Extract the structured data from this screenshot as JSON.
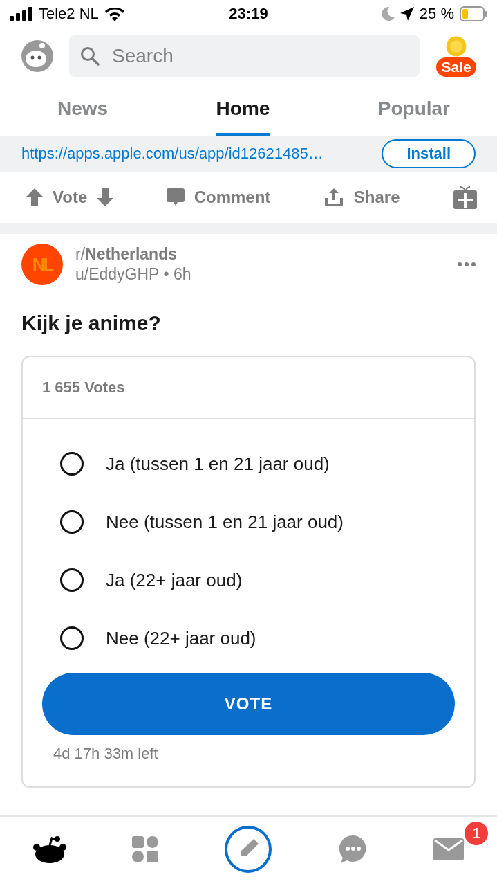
{
  "status_bar": {
    "carrier": "Tele2 NL",
    "time": "23:19",
    "battery": "25 %"
  },
  "header": {
    "search": {
      "placeholder": "Search"
    },
    "sale_badge": "Sale"
  },
  "tabs": [
    {
      "label": "News",
      "selected": false
    },
    {
      "label": "Home",
      "selected": true
    },
    {
      "label": "Popular",
      "selected": false
    }
  ],
  "ad": {
    "link": "https://apps.apple.com/us/app/id12621485…",
    "button": "Install"
  },
  "actions": {
    "vote": "Vote",
    "comment": "Comment",
    "share": "Share"
  },
  "post": {
    "subreddit_prefix": "r/",
    "subreddit": "Netherlands",
    "avatar_text": "NL",
    "author": "u/EddyGHP",
    "separator": "•",
    "age": "6h",
    "title": "Kijk je anime?",
    "poll": {
      "votes": "1 655 Votes",
      "options": [
        {
          "label": "Ja (tussen 1 en 21 jaar oud)",
          "selected": false
        },
        {
          "label": "Nee (tussen 1 en 21 jaar oud)",
          "selected": false
        },
        {
          "label": "Ja (22+ jaar oud)",
          "selected": false
        },
        {
          "label": "Nee (22+ jaar oud)",
          "selected": false
        }
      ],
      "button": "VOTE",
      "time_left": "4d 17h 33m left"
    }
  },
  "bottom_nav": {
    "inbox_badge": "1"
  }
}
